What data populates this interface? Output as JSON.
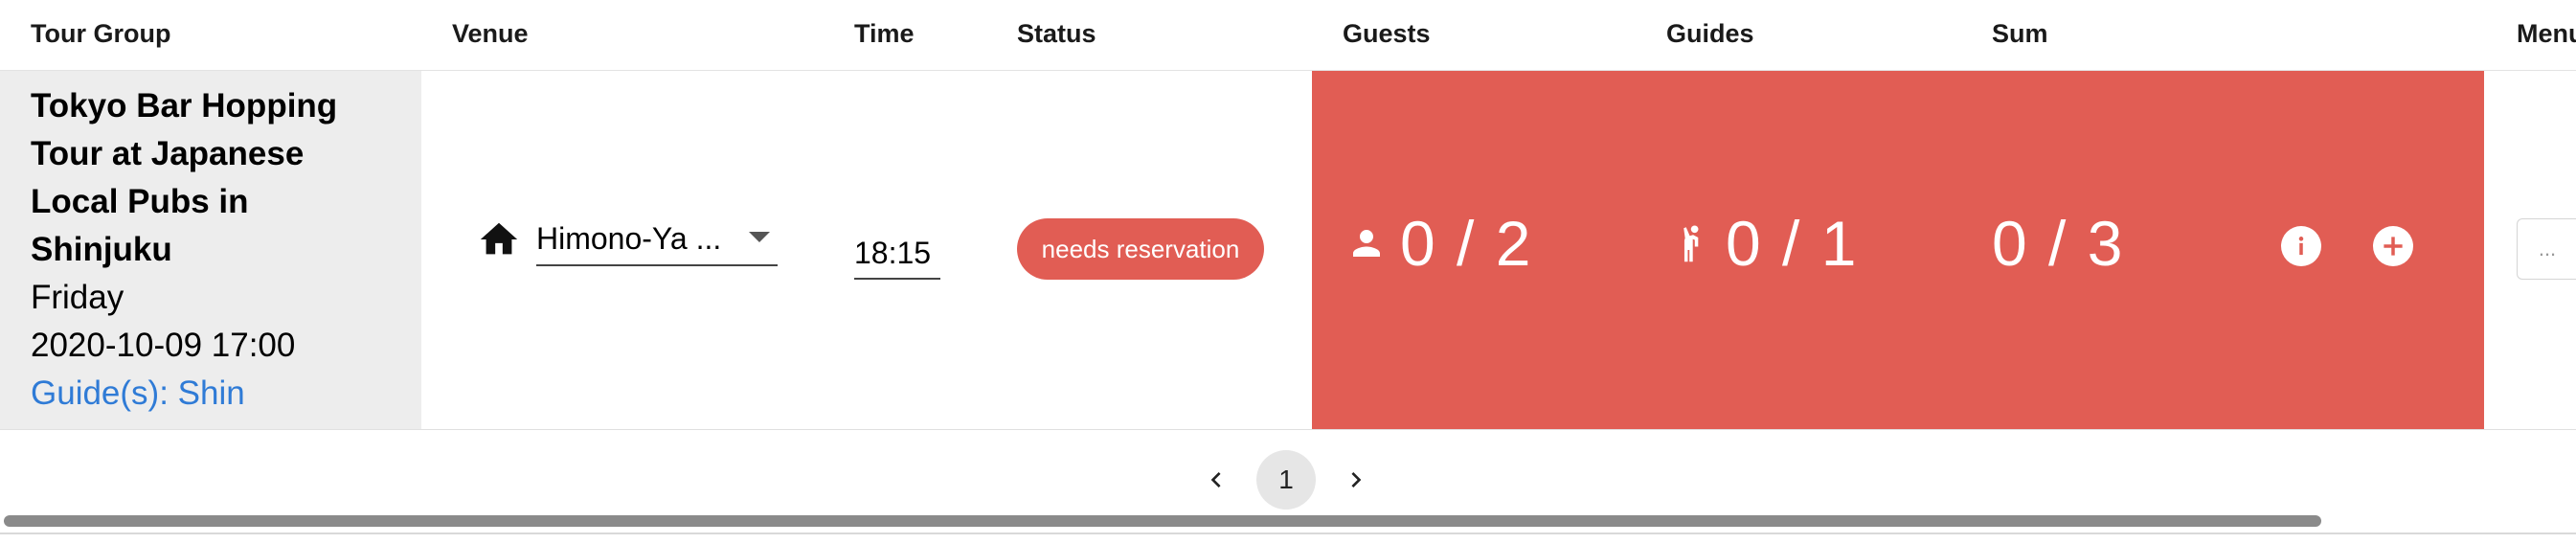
{
  "columns": {
    "tour_group": "Tour Group",
    "venue": "Venue",
    "time": "Time",
    "status": "Status",
    "guests": "Guests",
    "guides": "Guides",
    "sum": "Sum",
    "menu": "Menu"
  },
  "row": {
    "tour_name": "Tokyo Bar Hopping Tour at Japanese Local Pubs in Shinjuku",
    "day": "Friday",
    "datetime": "2020-10-09 17:00",
    "guides_text": "Guide(s): Shin",
    "venue_icon": "home-icon",
    "venue_value": "Himono-Ya ...",
    "time_value": "18:15",
    "status": "needs reservation",
    "guests_count": "0 / 2",
    "guides_count": "0 / 1",
    "sum_count": "0 / 3",
    "menu_value": "...",
    "highlight_color": "#e15d54"
  },
  "pagination": {
    "current_page": "1"
  },
  "colors": {
    "status_red": "#e15d54",
    "link_blue": "#2f7bd6",
    "group_cell_bg": "#ededed"
  }
}
